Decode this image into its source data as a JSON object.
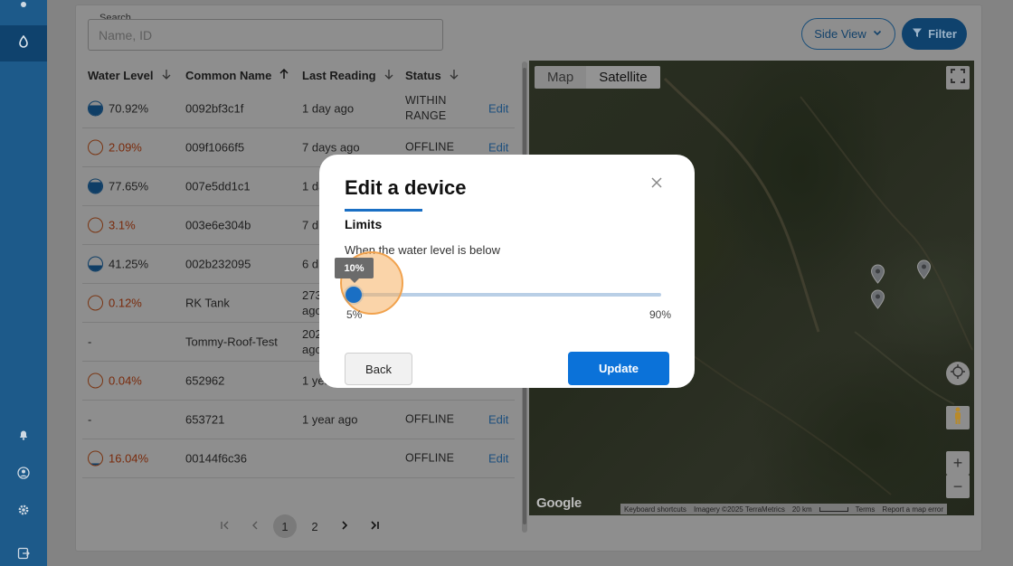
{
  "search": {
    "label": "Search",
    "placeholder": "Name, ID"
  },
  "toolbar": {
    "side_view_label": "Side View",
    "filter_label": "Filter"
  },
  "table": {
    "headers": {
      "water_level": "Water Level",
      "common_name": "Common Name",
      "last_reading": "Last Reading",
      "status": "Status"
    },
    "rows": [
      {
        "level": "70.92%",
        "name": "0092bf3c1f",
        "reading": "1 day ago",
        "status": "WITHIN RANGE",
        "edit": "Edit"
      },
      {
        "level": "2.09%",
        "name": "009f1066f5",
        "reading": "7 days ago",
        "status": "OFFLINE",
        "edit": "Edit"
      },
      {
        "level": "77.65%",
        "name": "007e5dd1c1",
        "reading": "1 da",
        "status": "",
        "edit": ""
      },
      {
        "level": "3.1%",
        "name": "003e6e304b",
        "reading": "7 d",
        "status": "",
        "edit": ""
      },
      {
        "level": "41.25%",
        "name": "002b232095",
        "reading": "6 d",
        "status": "",
        "edit": ""
      },
      {
        "level": "0.12%",
        "name": "RK Tank",
        "reading": "273 ago",
        "status": "",
        "edit": ""
      },
      {
        "level": "-",
        "name": "Tommy-Roof-Test",
        "reading": "202 ago",
        "status": "",
        "edit": ""
      },
      {
        "level": "0.04%",
        "name": "652962",
        "reading": "1 yea",
        "status": "",
        "edit": ""
      },
      {
        "level": "-",
        "name": "653721",
        "reading": "1 year ago",
        "status": "OFFLINE",
        "edit": "Edit"
      },
      {
        "level": "16.04%",
        "name": "00144f6c36",
        "reading": "",
        "status": "OFFLINE",
        "edit": "Edit"
      }
    ]
  },
  "pagination": {
    "pages": [
      "1",
      "2"
    ],
    "current": "1"
  },
  "map": {
    "type_map": "Map",
    "type_satellite": "Satellite",
    "logo": "Google",
    "attribution": {
      "shortcuts": "Keyboard shortcuts",
      "imagery": "Imagery ©2025 TerraMetrics",
      "scale": "20 km",
      "terms": "Terms",
      "report": "Report a map error"
    },
    "zoom_in": "+",
    "zoom_out": "−"
  },
  "modal": {
    "title": "Edit a device",
    "section": "Limits",
    "prompt": "When the water level is below",
    "slider": {
      "value_label": "10%",
      "value": 10,
      "min_label": "5%",
      "max_label": "90%"
    },
    "back_label": "Back",
    "update_label": "Update"
  },
  "colors": {
    "primary": "#0b72d9",
    "sidebar": "#1d5a8a",
    "low_level": "#c9571f",
    "halo": "#f6b062"
  }
}
